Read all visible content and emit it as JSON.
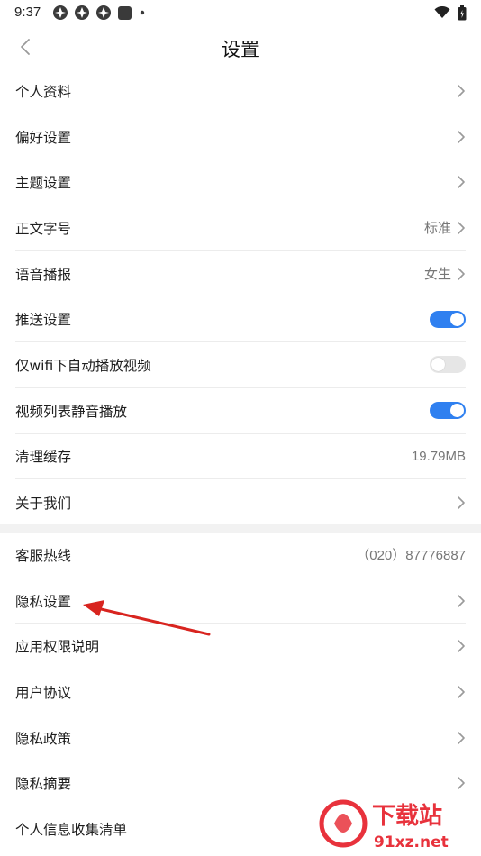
{
  "status_bar": {
    "time": "9:37",
    "icons": [
      "app-notification-icon",
      "app-notification-icon",
      "app-notification-icon",
      "square-app-icon",
      "dot-icon"
    ],
    "right_icons": [
      "wifi-icon",
      "battery-icon"
    ]
  },
  "header": {
    "title": "设置",
    "back_icon": "chevron-left-icon"
  },
  "settings_group_1": [
    {
      "label": "个人资料",
      "value": "",
      "control": "chevron"
    },
    {
      "label": "偏好设置",
      "value": "",
      "control": "chevron"
    },
    {
      "label": "主题设置",
      "value": "",
      "control": "chevron"
    },
    {
      "label": "正文字号",
      "value": "标准",
      "control": "chevron"
    },
    {
      "label": "语音播报",
      "value": "女生",
      "control": "chevron"
    },
    {
      "label": "推送设置",
      "value": "",
      "control": "toggle",
      "on": true
    },
    {
      "label": "仅wifi下自动播放视频",
      "value": "",
      "control": "toggle",
      "on": false
    },
    {
      "label": "视频列表静音播放",
      "value": "",
      "control": "toggle",
      "on": true
    },
    {
      "label": "清理缓存",
      "value": "19.79MB",
      "control": "none"
    },
    {
      "label": "关于我们",
      "value": "",
      "control": "chevron"
    }
  ],
  "settings_group_2": [
    {
      "label": "客服热线",
      "value": "（020）87776887",
      "control": "none"
    },
    {
      "label": "隐私设置",
      "value": "",
      "control": "chevron"
    },
    {
      "label": "应用权限说明",
      "value": "",
      "control": "chevron"
    },
    {
      "label": "用户协议",
      "value": "",
      "control": "chevron"
    },
    {
      "label": "隐私政策",
      "value": "",
      "control": "chevron"
    },
    {
      "label": "隐私摘要",
      "value": "",
      "control": "chevron"
    },
    {
      "label": "个人信息收集清单",
      "value": "",
      "control": "none"
    }
  ],
  "watermark": {
    "brand": "下载站",
    "url": "91xz.net"
  },
  "colors": {
    "toggle_on": "#2f80f0",
    "toggle_off": "#e6e6e6",
    "annotation_arrow": "#d8241f",
    "watermark_red": "#e8323c"
  }
}
